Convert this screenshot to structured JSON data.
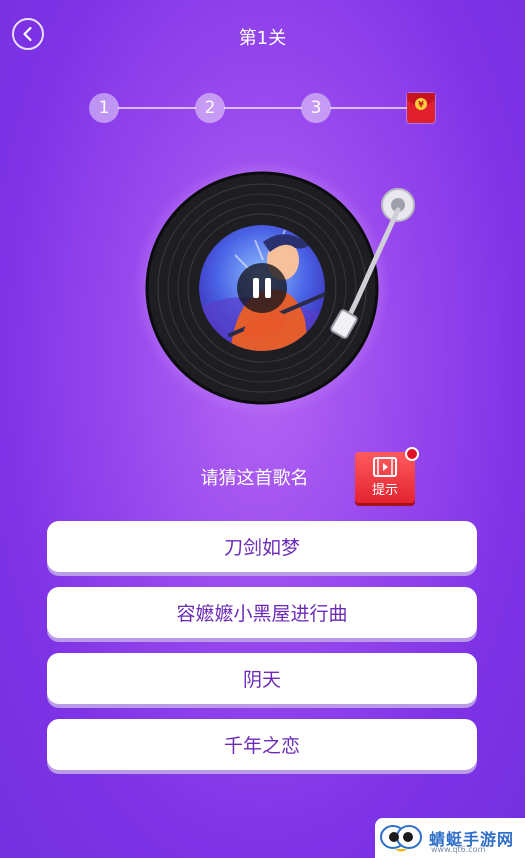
{
  "header": {
    "title": "第1关"
  },
  "progress": {
    "steps": [
      "1",
      "2",
      "3"
    ],
    "reward_coin": "¥",
    "colors": {
      "reward_envelope": "#e11f2f",
      "coin": "#ffce3b"
    }
  },
  "player": {
    "state": "playing",
    "control_icon": "pause-icon"
  },
  "question": {
    "prompt": "请猜这首歌名",
    "hint_label": "提示"
  },
  "options": [
    "刀剑如梦",
    "容嬷嬷小黑屋进行曲",
    "阴天",
    "千年之恋"
  ],
  "watermark": {
    "text": "蜻蜓手游网",
    "sub": "www.qt6.com"
  },
  "colors": {
    "background_top": "#9a4bee",
    "background_edge": "#7230df",
    "option_text": "#6b2bb8",
    "hint_button": "#e3242f"
  }
}
